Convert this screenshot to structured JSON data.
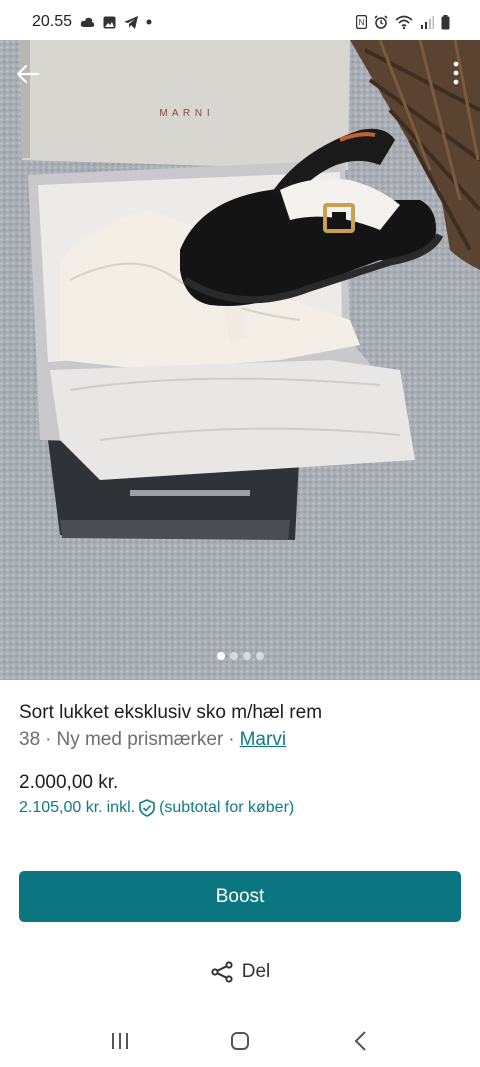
{
  "status_bar": {
    "time": "20.55"
  },
  "product": {
    "title": "Sort lukket eksklusiv sko m/hæl rem",
    "size": "38",
    "separator_1": "·",
    "condition": "Ny med prismærker",
    "separator_2": "·",
    "brand": "Marvi",
    "box_brand": "M A R N I",
    "price": "2.000,00 kr.",
    "price_incl": "2.105,00 kr.",
    "incl_label": "inkl.",
    "incl_suffix": "(subtotal for køber)"
  },
  "gallery": {
    "image_count": 4,
    "current_index": 1
  },
  "actions": {
    "boost_label": "Boost",
    "share_label": "Del"
  },
  "colors": {
    "accent": "#0b7680",
    "link": "#0e7c86"
  }
}
